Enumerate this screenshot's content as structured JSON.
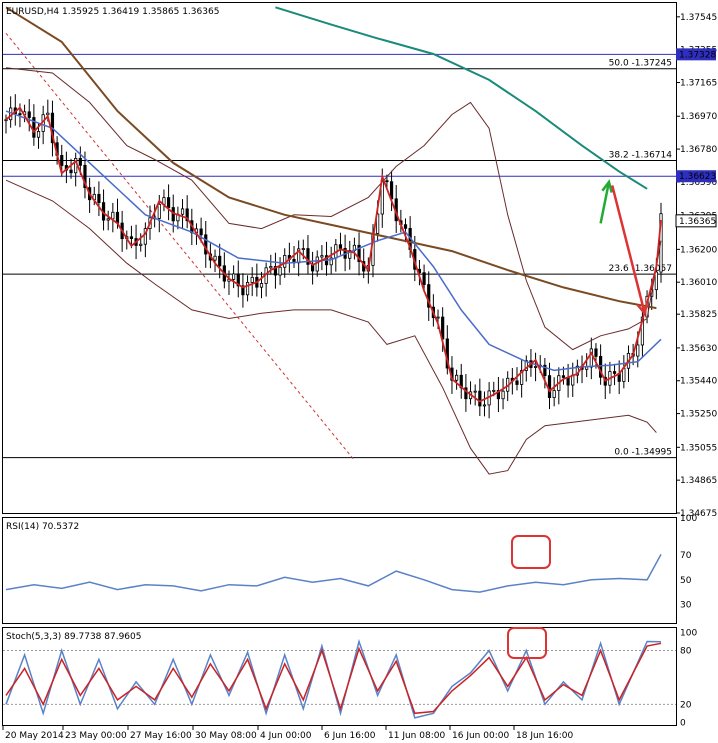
{
  "chart_data": [
    {
      "type": "candlestick",
      "title": "EURUSD,H4  1.35925 1.36419 1.35865 1.36365",
      "price_ticks": [
        1.37545,
        1.37355,
        1.37165,
        1.3697,
        1.3678,
        1.3659,
        1.36395,
        1.362,
        1.3601,
        1.35825,
        1.3563,
        1.3544,
        1.3525,
        1.35055,
        1.34865,
        1.34675
      ],
      "ylim": [
        1.34675,
        1.37625
      ],
      "price_markers": [
        {
          "label": "1.37328",
          "value": 1.37328,
          "color": "#2f2fbf"
        },
        {
          "label": "1.36623",
          "value": 1.36623,
          "color": "#2f2fbf"
        },
        {
          "label": "1.36365",
          "value": 1.36365,
          "color": "#000000"
        }
      ],
      "fib_levels": [
        {
          "label": "50.0 -1.37245",
          "value": 1.37245
        },
        {
          "label": "38.2 -1.36714",
          "value": 1.36714
        },
        {
          "label": "23.6 -1.36057",
          "value": 1.36057
        },
        {
          "label": "0.0 -1.34995",
          "value": 1.34995
        }
      ],
      "x_labels": [
        "20 May 2014",
        "23 May 00:00",
        "27 May 16:00",
        "30 May 08:00",
        "4 Jun 00:00",
        "6 Jun 16:00",
        "11 Jun 08:00",
        "16 Jun 00:00",
        "18 Jun 16:00"
      ],
      "close_path": [
        [
          0,
          1.3695
        ],
        [
          3,
          1.3702
        ],
        [
          6,
          1.3688
        ],
        [
          9,
          1.3697
        ],
        [
          12,
          1.3664
        ],
        [
          15,
          1.3671
        ],
        [
          18,
          1.3652
        ],
        [
          21,
          1.3641
        ],
        [
          24,
          1.3635
        ],
        [
          27,
          1.3622
        ],
        [
          30,
          1.3629
        ],
        [
          33,
          1.3648
        ],
        [
          36,
          1.3641
        ],
        [
          39,
          1.3638
        ],
        [
          42,
          1.3625
        ],
        [
          45,
          1.3612
        ],
        [
          48,
          1.3603
        ],
        [
          51,
          1.3598
        ],
        [
          54,
          1.3601
        ],
        [
          57,
          1.3608
        ],
        [
          60,
          1.3612
        ],
        [
          63,
          1.3619
        ],
        [
          66,
          1.3611
        ],
        [
          69,
          1.3615
        ],
        [
          72,
          1.362
        ],
        [
          75,
          1.3618
        ],
        [
          78,
          1.3608
        ],
        [
          81,
          1.3662
        ],
        [
          84,
          1.3641
        ],
        [
          87,
          1.3621
        ],
        [
          90,
          1.3596
        ],
        [
          93,
          1.3577
        ],
        [
          96,
          1.3545
        ],
        [
          99,
          1.3538
        ],
        [
          102,
          1.3532
        ],
        [
          105,
          1.3536
        ],
        [
          108,
          1.3541
        ],
        [
          111,
          1.3549
        ],
        [
          114,
          1.3556
        ],
        [
          117,
          1.3538
        ],
        [
          120,
          1.3545
        ],
        [
          123,
          1.3548
        ],
        [
          126,
          1.356
        ],
        [
          129,
          1.3544
        ],
        [
          132,
          1.3548
        ],
        [
          135,
          1.3559
        ],
        [
          138,
          1.3589
        ],
        [
          140,
          1.361
        ],
        [
          141,
          1.3637
        ]
      ],
      "upper_band": [
        [
          0,
          1.3725
        ],
        [
          10,
          1.3722
        ],
        [
          18,
          1.3705
        ],
        [
          26,
          1.368
        ],
        [
          32,
          1.3672
        ],
        [
          40,
          1.366
        ],
        [
          48,
          1.3635
        ],
        [
          55,
          1.3632
        ],
        [
          62,
          1.364
        ],
        [
          70,
          1.3639
        ],
        [
          78,
          1.365
        ],
        [
          84,
          1.3668
        ],
        [
          90,
          1.368
        ],
        [
          96,
          1.3698
        ],
        [
          100,
          1.3705
        ],
        [
          104,
          1.369
        ],
        [
          108,
          1.364
        ],
        [
          112,
          1.3602
        ],
        [
          116,
          1.3575
        ],
        [
          122,
          1.3562
        ],
        [
          128,
          1.357
        ],
        [
          134,
          1.3574
        ],
        [
          138,
          1.358
        ],
        [
          141,
          1.3625
        ]
      ],
      "lower_band": [
        [
          0,
          1.366
        ],
        [
          10,
          1.3648
        ],
        [
          18,
          1.3632
        ],
        [
          26,
          1.3612
        ],
        [
          32,
          1.36
        ],
        [
          40,
          1.3585
        ],
        [
          48,
          1.358
        ],
        [
          55,
          1.3583
        ],
        [
          62,
          1.3585
        ],
        [
          70,
          1.3585
        ],
        [
          78,
          1.3578
        ],
        [
          82,
          1.3565
        ],
        [
          88,
          1.357
        ],
        [
          94,
          1.354
        ],
        [
          100,
          1.3505
        ],
        [
          104,
          1.349
        ],
        [
          108,
          1.3492
        ],
        [
          112,
          1.351
        ],
        [
          116,
          1.3518
        ],
        [
          122,
          1.352
        ],
        [
          128,
          1.3522
        ],
        [
          134,
          1.3524
        ],
        [
          138,
          1.352
        ],
        [
          140,
          1.3514
        ]
      ],
      "ma_brown": [
        [
          0,
          1.376
        ],
        [
          12,
          1.374
        ],
        [
          24,
          1.37
        ],
        [
          36,
          1.367
        ],
        [
          48,
          1.365
        ],
        [
          60,
          1.364
        ],
        [
          72,
          1.3633
        ],
        [
          84,
          1.3626
        ],
        [
          96,
          1.3619
        ],
        [
          108,
          1.3608
        ],
        [
          120,
          1.3598
        ],
        [
          132,
          1.359
        ],
        [
          140,
          1.3586
        ]
      ],
      "ma_teal": [
        [
          58,
          1.376
        ],
        [
          70,
          1.375
        ],
        [
          80,
          1.3742
        ],
        [
          92,
          1.3733
        ],
        [
          104,
          1.3718
        ],
        [
          114,
          1.37
        ],
        [
          124,
          1.368
        ],
        [
          132,
          1.3665
        ],
        [
          138,
          1.3655
        ]
      ],
      "ma_blue": [
        [
          0,
          1.37
        ],
        [
          10,
          1.369
        ],
        [
          20,
          1.3665
        ],
        [
          30,
          1.364
        ],
        [
          40,
          1.363
        ],
        [
          50,
          1.3615
        ],
        [
          60,
          1.3612
        ],
        [
          70,
          1.3614
        ],
        [
          80,
          1.3625
        ],
        [
          86,
          1.363
        ],
        [
          92,
          1.361
        ],
        [
          98,
          1.3585
        ],
        [
          104,
          1.3565
        ],
        [
          112,
          1.3555
        ],
        [
          118,
          1.355
        ],
        [
          124,
          1.3552
        ],
        [
          130,
          1.3553
        ],
        [
          136,
          1.3555
        ],
        [
          141,
          1.3568
        ]
      ],
      "arrows": [
        {
          "color": "#22aa33",
          "direction": "up",
          "from": [
            128,
            1.3635
          ],
          "to": [
            129.8,
            1.3659
          ]
        },
        {
          "color": "#dd3333",
          "direction": "down",
          "from": [
            130.5,
            1.3657
          ],
          "to": [
            137.5,
            1.3583
          ]
        }
      ]
    },
    {
      "type": "line",
      "title": "RSI(14) 70.5372",
      "ylim": [
        15,
        100
      ],
      "ticks": [
        100,
        70,
        50,
        30
      ],
      "values": [
        [
          0,
          42
        ],
        [
          6,
          46
        ],
        [
          12,
          43
        ],
        [
          18,
          48
        ],
        [
          24,
          42
        ],
        [
          30,
          46
        ],
        [
          36,
          45
        ],
        [
          42,
          41
        ],
        [
          48,
          46
        ],
        [
          54,
          45
        ],
        [
          60,
          52
        ],
        [
          66,
          48
        ],
        [
          72,
          51
        ],
        [
          78,
          45
        ],
        [
          84,
          57
        ],
        [
          90,
          50
        ],
        [
          96,
          42
        ],
        [
          102,
          40
        ],
        [
          108,
          45
        ],
        [
          114,
          48
        ],
        [
          120,
          46
        ],
        [
          126,
          50
        ],
        [
          132,
          51
        ],
        [
          138,
          50
        ],
        [
          141,
          70.5
        ]
      ]
    },
    {
      "type": "line",
      "title": "Stoch(5,3,3) 89.7738 87.9605",
      "ylim": [
        -3,
        105
      ],
      "ticks": [
        100,
        80,
        20,
        0
      ],
      "values": [
        [
          0,
          20
        ],
        [
          4,
          75
        ],
        [
          8,
          10
        ],
        [
          12,
          80
        ],
        [
          16,
          20
        ],
        [
          20,
          70
        ],
        [
          24,
          15
        ],
        [
          28,
          45
        ],
        [
          32,
          20
        ],
        [
          36,
          70
        ],
        [
          40,
          20
        ],
        [
          44,
          75
        ],
        [
          48,
          30
        ],
        [
          52,
          78
        ],
        [
          56,
          10
        ],
        [
          60,
          75
        ],
        [
          64,
          15
        ],
        [
          68,
          85
        ],
        [
          72,
          10
        ],
        [
          76,
          90
        ],
        [
          80,
          30
        ],
        [
          84,
          75
        ],
        [
          88,
          5
        ],
        [
          92,
          10
        ],
        [
          96,
          40
        ],
        [
          100,
          55
        ],
        [
          104,
          80
        ],
        [
          108,
          35
        ],
        [
          112,
          80
        ],
        [
          116,
          20
        ],
        [
          120,
          45
        ],
        [
          124,
          25
        ],
        [
          128,
          88
        ],
        [
          132,
          20
        ],
        [
          138,
          90
        ],
        [
          141,
          89.8
        ]
      ],
      "signal": [
        [
          0,
          30
        ],
        [
          4,
          60
        ],
        [
          8,
          20
        ],
        [
          12,
          70
        ],
        [
          16,
          30
        ],
        [
          20,
          60
        ],
        [
          24,
          25
        ],
        [
          28,
          40
        ],
        [
          32,
          25
        ],
        [
          36,
          60
        ],
        [
          40,
          28
        ],
        [
          44,
          65
        ],
        [
          48,
          35
        ],
        [
          52,
          70
        ],
        [
          56,
          15
        ],
        [
          60,
          65
        ],
        [
          64,
          25
        ],
        [
          68,
          80
        ],
        [
          72,
          15
        ],
        [
          76,
          82
        ],
        [
          80,
          35
        ],
        [
          84,
          68
        ],
        [
          88,
          10
        ],
        [
          92,
          12
        ],
        [
          96,
          35
        ],
        [
          100,
          52
        ],
        [
          104,
          72
        ],
        [
          108,
          40
        ],
        [
          112,
          72
        ],
        [
          116,
          25
        ],
        [
          120,
          42
        ],
        [
          124,
          30
        ],
        [
          128,
          80
        ],
        [
          132,
          25
        ],
        [
          138,
          85
        ],
        [
          141,
          88.0
        ]
      ]
    }
  ]
}
